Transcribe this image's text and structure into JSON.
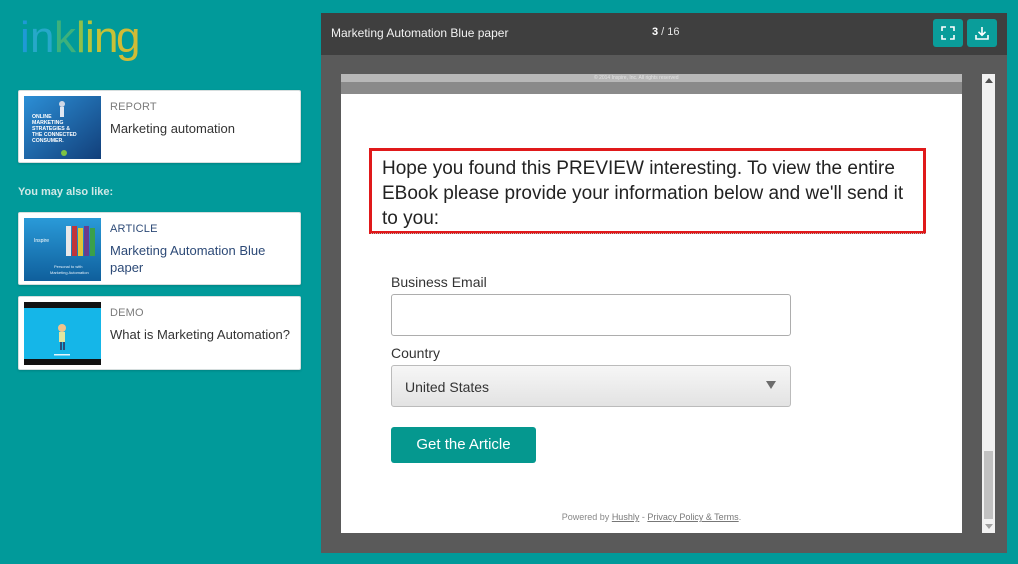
{
  "brand": {
    "logo_text": "inkling"
  },
  "sidebar": {
    "current": {
      "type": "REPORT",
      "title": "Marketing automation",
      "thumb_text": "ONLINE MARKETING STRATEGIES & THE CONNECTED CONSUMER."
    },
    "also_label": "You may also like:",
    "items": [
      {
        "type": "ARTICLE",
        "title": "Marketing Automation Blue paper"
      },
      {
        "type": "DEMO",
        "title": "What is Marketing Automation?"
      }
    ]
  },
  "viewer": {
    "title": "Marketing Automation Blue paper",
    "page_current": "3",
    "page_sep": " / ",
    "page_total": "16",
    "page_copyright": "© 2014   Inspire, Inc.   All rights reserved",
    "preview_message": "Hope you found this PREVIEW interesting. To view the entire EBook please provide your information below and we'll send it to you:",
    "form": {
      "email_label": "Business Email",
      "email_value": "",
      "country_label": "Country",
      "country_value": "United States",
      "submit_label": "Get the Article"
    },
    "footer": {
      "powered_prefix": "Powered by ",
      "hushly": "Hushly",
      "dash": " - ",
      "privacy": "Privacy Policy & Terms",
      "end": "."
    }
  },
  "colors": {
    "background": "#019a9a",
    "accent": "#05988f",
    "highlight_border": "#e0191a"
  }
}
